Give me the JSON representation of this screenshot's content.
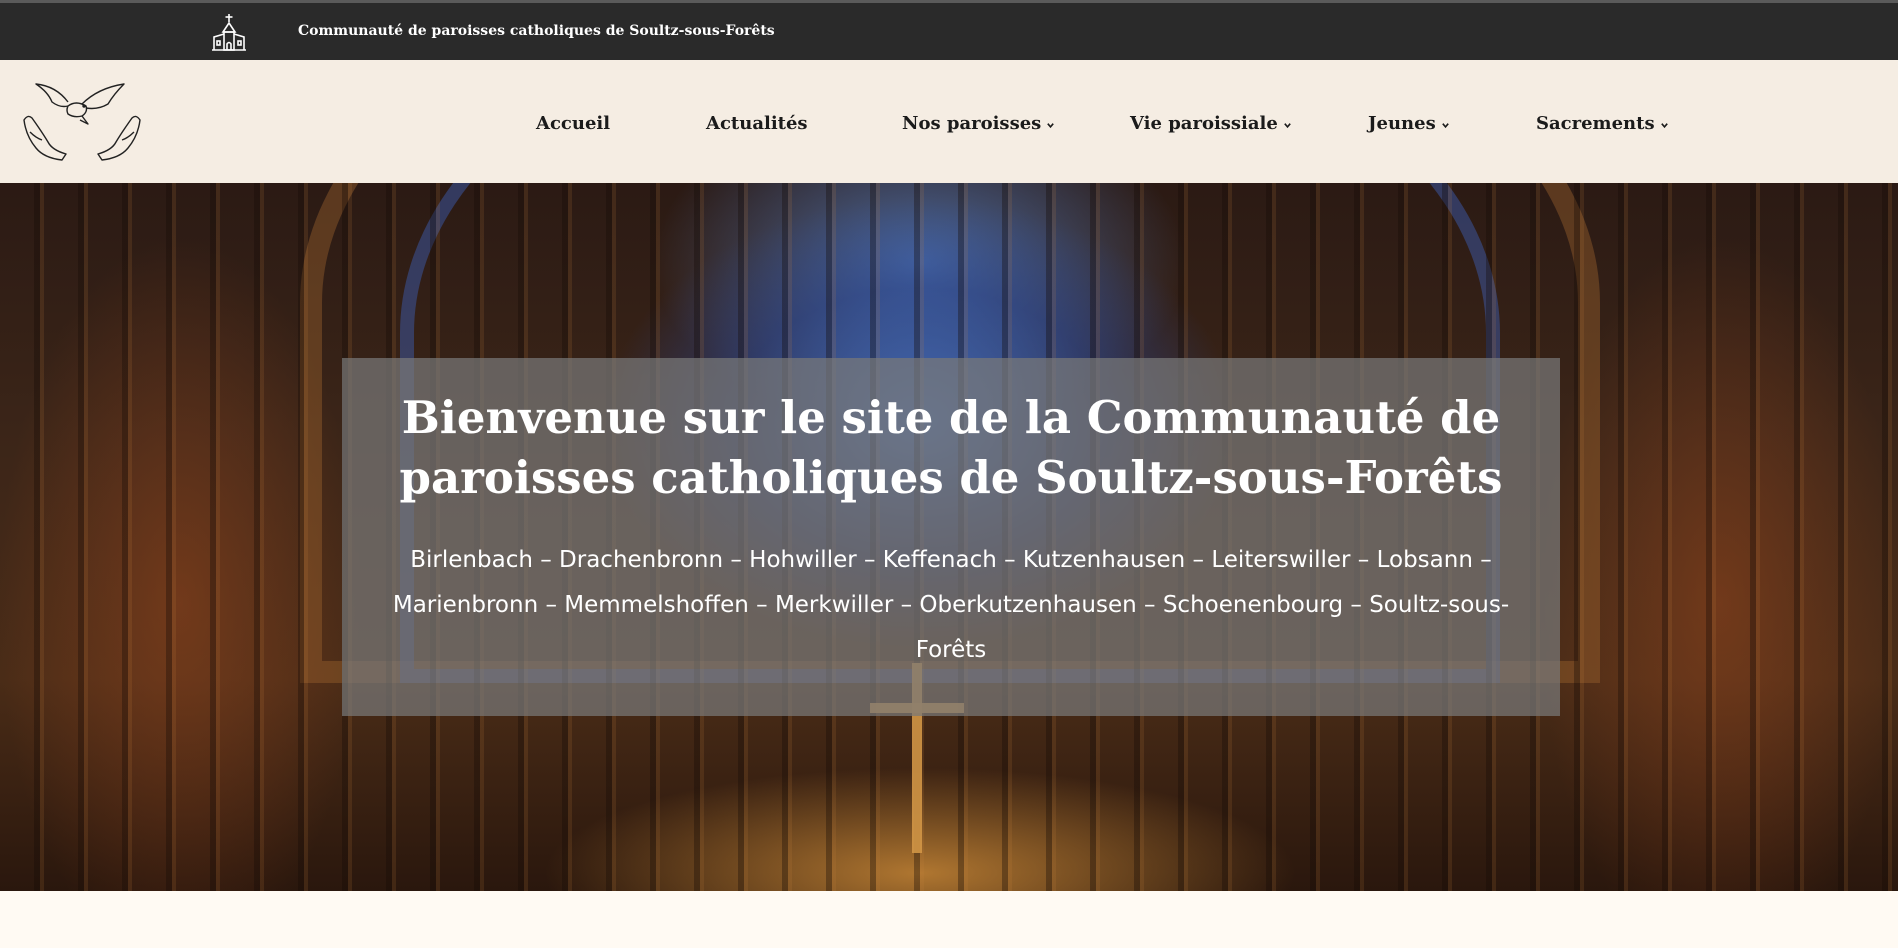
{
  "topbar": {
    "title": "Communauté de paroisses catholiques de Soultz-sous-Forêts",
    "icon": "church-icon"
  },
  "header": {
    "logo_icon": "dove-hands-logo",
    "nav": [
      {
        "label": "Accueil",
        "dropdown": false
      },
      {
        "label": "Actualités",
        "dropdown": false
      },
      {
        "label": "Nos paroisses",
        "dropdown": true
      },
      {
        "label": "Vie paroissiale",
        "dropdown": true
      },
      {
        "label": "Jeunes",
        "dropdown": true
      },
      {
        "label": "Sacrements",
        "dropdown": true
      }
    ]
  },
  "hero": {
    "title": "Bienvenue sur le site de la Communauté de paroisses catholiques de Soultz-sous-Forêts",
    "subtitle": "Birlenbach – Drachenbronn – Hohwiller – Keffenach – Kutzenhausen – Leiterswiller – Lobsann – Marienbronn – Memmelshoffen – Merkwiller – Oberkutzenhausen – Schoenenbourg – Soultz-sous-Forêts"
  },
  "colors": {
    "topbar_bg": "#2a2a2a",
    "nav_bg": "#f5ede3",
    "page_bg": "#fffaf3",
    "overlay": "#787878"
  }
}
